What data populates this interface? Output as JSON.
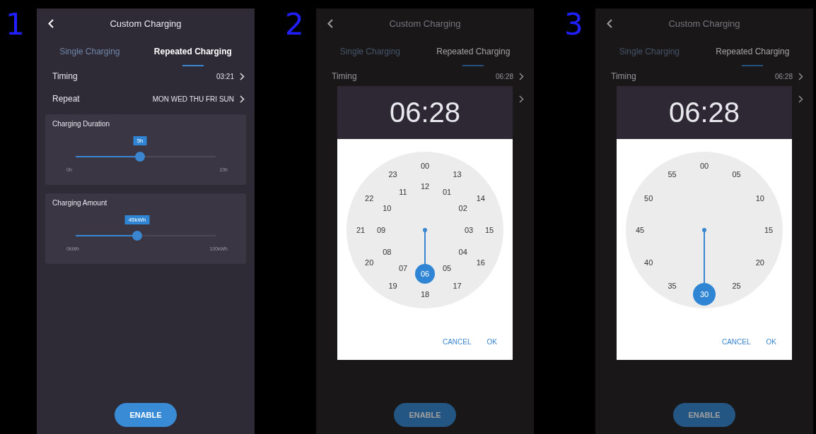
{
  "screens": [
    {
      "number": "1",
      "dimmed": false,
      "header": {
        "title": "Custom Charging"
      },
      "tabs": [
        {
          "label": "Single Charging",
          "selected": false
        },
        {
          "label": "Repeated Charging",
          "selected": true
        }
      ],
      "settings": [
        {
          "kind": "setting",
          "label": "Timing",
          "value": "03:21"
        },
        {
          "kind": "setting",
          "label": "Repeat",
          "value": "MON WED THU FRI SUN"
        }
      ],
      "sliders": [
        {
          "title": "Charging Duration",
          "reading": "5h",
          "min": "0h",
          "max": "10h",
          "level": 0.46
        },
        {
          "title": "Charging Amount",
          "reading": "45kWh",
          "min": "0kWh",
          "max": "100kWh",
          "level": 0.44
        }
      ],
      "enable_button": {
        "label": "ENABLE"
      }
    },
    {
      "number": "2",
      "dimmed": true,
      "header": {
        "title": "Custom Charging"
      },
      "tabs": [
        {
          "label": "Single Charging",
          "selected": false
        },
        {
          "label": "Repeated Charging",
          "selected": true
        }
      ],
      "settings": [
        {
          "kind": "setting",
          "label": "Timing",
          "value": "06:28"
        },
        {
          "kind": "setting"
        }
      ],
      "enable_button": {
        "label": "ENABLE"
      },
      "dialog": {
        "time": "06:28",
        "rings": [
          {
            "kind": "outer",
            "labels": [
              {
                "text": "00",
                "selected": false
              },
              {
                "text": "13",
                "selected": false
              },
              {
                "text": "14",
                "selected": false
              },
              {
                "text": "15",
                "selected": false
              },
              {
                "text": "16",
                "selected": false
              },
              {
                "text": "17",
                "selected": false
              },
              {
                "text": "18",
                "selected": false
              },
              {
                "text": "19",
                "selected": false
              },
              {
                "text": "20",
                "selected": false
              },
              {
                "text": "21",
                "selected": false
              },
              {
                "text": "22",
                "selected": false
              },
              {
                "text": "23",
                "selected": false
              }
            ]
          },
          {
            "kind": "inner",
            "labels": [
              {
                "text": "12",
                "selected": false
              },
              {
                "text": "01",
                "selected": false
              },
              {
                "text": "02",
                "selected": false
              },
              {
                "text": "03",
                "selected": false
              },
              {
                "text": "04",
                "selected": false
              },
              {
                "text": "05",
                "selected": false
              },
              {
                "text": "06",
                "selected": true
              },
              {
                "text": "07",
                "selected": false
              },
              {
                "text": "08",
                "selected": false
              },
              {
                "text": "09",
                "selected": false
              },
              {
                "text": "10",
                "selected": false
              },
              {
                "text": "11",
                "selected": false
              }
            ]
          }
        ],
        "buttons": [
          "CANCEL",
          "OK"
        ]
      }
    },
    {
      "number": "3",
      "dimmed": true,
      "header": {
        "title": "Custom Charging"
      },
      "tabs": [
        {
          "label": "Single Charging",
          "selected": false
        },
        {
          "label": "Repeated Charging",
          "selected": true
        }
      ],
      "settings": [
        {
          "kind": "setting",
          "label": "Timing",
          "value": "06:28"
        },
        {
          "kind": "setting"
        }
      ],
      "enable_button": {
        "label": "ENABLE"
      },
      "dialog": {
        "time": "06:28",
        "rings": [
          {
            "kind": "outer",
            "labels": [
              {
                "text": "00",
                "selected": false
              },
              {
                "text": "05",
                "selected": false
              },
              {
                "text": "10",
                "selected": false
              },
              {
                "text": "15",
                "selected": false
              },
              {
                "text": "20",
                "selected": false
              },
              {
                "text": "25",
                "selected": false
              },
              {
                "text": "30",
                "selected": true
              },
              {
                "text": "35",
                "selected": false
              },
              {
                "text": "40",
                "selected": false
              },
              {
                "text": "45",
                "selected": false
              },
              {
                "text": "50",
                "selected": false
              },
              {
                "text": "55",
                "selected": false
              }
            ]
          }
        ],
        "buttons": [
          "CANCEL",
          "OK"
        ]
      }
    }
  ]
}
